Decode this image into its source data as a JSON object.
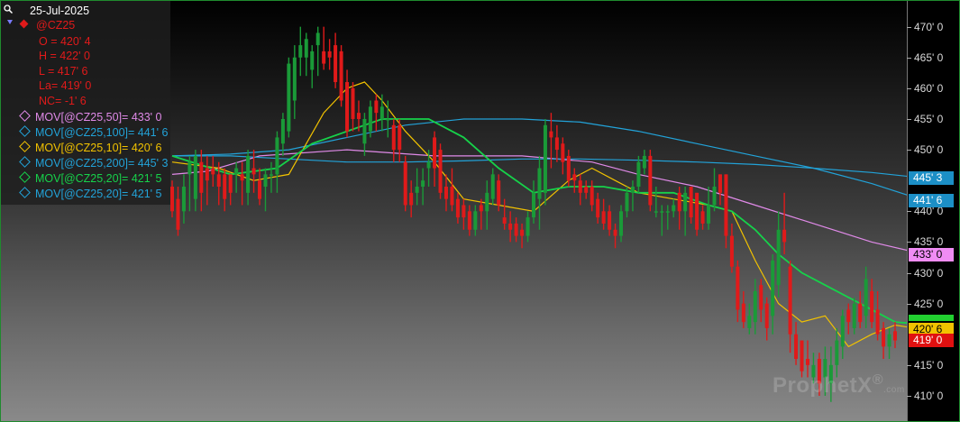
{
  "legend": {
    "date": "25-Jul-2025",
    "symbol": "@CZ25",
    "ohlc": [
      "O = 420' 4",
      "H = 422' 0",
      "L = 417' 6",
      "La= 419' 0",
      "NC= -1' 6"
    ],
    "studies": [
      {
        "label": "MOV[@CZ25,50]= 433' 0",
        "color": "#e08ae8"
      },
      {
        "label": "MOV[@CZ25,100]= 441' 6",
        "color": "#22a3d9"
      },
      {
        "label": "MOV[@CZ25,10]= 420' 6",
        "color": "#f2c200"
      },
      {
        "label": "MOV[@CZ25,200]= 445' 3",
        "color": "#22a3d9"
      },
      {
        "label": "MOV[@CZ25,20]= 421' 5",
        "color": "#16d24a"
      },
      {
        "label": "MOV[@CZ25,20]= 421' 5",
        "color": "#22a3d9"
      }
    ],
    "icons": {
      "zoom": "magnifier-icon",
      "collapse": "triangle-down-icon",
      "symbol": "red-diamond-icon"
    }
  },
  "axis": {
    "ticks": [
      {
        "label": "470' 0",
        "value": 470
      },
      {
        "label": "465' 0",
        "value": 465
      },
      {
        "label": "460' 0",
        "value": 460
      },
      {
        "label": "455' 0",
        "value": 455
      },
      {
        "label": "450' 0",
        "value": 450
      },
      {
        "label": "440' 0",
        "value": 440
      },
      {
        "label": "435' 0",
        "value": 435
      },
      {
        "label": "430' 0",
        "value": 430
      },
      {
        "label": "425' 0",
        "value": 425
      },
      {
        "label": "415' 0",
        "value": 415
      },
      {
        "label": "410' 0",
        "value": 410
      }
    ],
    "price_tags": [
      {
        "label": "445' 3",
        "value": 445.4,
        "bg": "#1c8fc6",
        "fg": "#ffffff"
      },
      {
        "label": "441' 6",
        "value": 441.75,
        "bg": "#1c8fc6",
        "fg": "#ffffff"
      },
      {
        "label": "433' 0",
        "value": 433,
        "bg": "#f08cf4",
        "fg": "#000000"
      },
      {
        "label": "",
        "value": 422.6,
        "bg": "#22d030",
        "fg": "#000000"
      },
      {
        "label": "420' 6",
        "value": 420.75,
        "bg": "#f2c200",
        "fg": "#000000"
      },
      {
        "label": "419' 0",
        "value": 419,
        "bg": "#e01010",
        "fg": "#ffffff"
      }
    ]
  },
  "watermark": {
    "brand": "ProphetX",
    "mark": "®",
    "suffix": ".com"
  },
  "chart_data": {
    "type": "candlestick",
    "symbol": "@CZ25",
    "ylim": [
      407.5,
      472
    ],
    "up_color": "#1a9a38",
    "down_color": "#e01a1a",
    "candles": [
      {
        "o": 444,
        "h": 445,
        "l": 439,
        "c": 440
      },
      {
        "o": 442,
        "h": 444,
        "l": 436,
        "c": 437
      },
      {
        "o": 440,
        "h": 446,
        "l": 438,
        "c": 444
      },
      {
        "o": 446,
        "h": 449,
        "l": 440,
        "c": 448
      },
      {
        "o": 442,
        "h": 450,
        "l": 440,
        "c": 449
      },
      {
        "o": 448,
        "h": 450,
        "l": 440,
        "c": 443
      },
      {
        "o": 447,
        "h": 449,
        "l": 441,
        "c": 445
      },
      {
        "o": 447,
        "h": 449,
        "l": 444,
        "c": 446
      },
      {
        "o": 446,
        "h": 448,
        "l": 441,
        "c": 444
      },
      {
        "o": 446,
        "h": 447,
        "l": 440,
        "c": 442
      },
      {
        "o": 446,
        "h": 446,
        "l": 441,
        "c": 443
      },
      {
        "o": 446,
        "h": 448,
        "l": 443,
        "c": 447
      },
      {
        "o": 446,
        "h": 448,
        "l": 441,
        "c": 445
      },
      {
        "o": 443,
        "h": 450,
        "l": 441,
        "c": 449
      },
      {
        "o": 447,
        "h": 450,
        "l": 443,
        "c": 446
      },
      {
        "o": 445,
        "h": 447,
        "l": 441,
        "c": 442
      },
      {
        "o": 444,
        "h": 447,
        "l": 440,
        "c": 446
      },
      {
        "o": 446,
        "h": 448,
        "l": 443,
        "c": 446
      },
      {
        "o": 446,
        "h": 453,
        "l": 443,
        "c": 452
      },
      {
        "o": 451,
        "h": 456,
        "l": 449,
        "c": 455
      },
      {
        "o": 453,
        "h": 465,
        "l": 452,
        "c": 464
      },
      {
        "o": 458,
        "h": 467,
        "l": 455,
        "c": 465
      },
      {
        "o": 465,
        "h": 470,
        "l": 462,
        "c": 467
      },
      {
        "o": 465,
        "h": 469,
        "l": 462,
        "c": 468
      },
      {
        "o": 463,
        "h": 467,
        "l": 460,
        "c": 466
      },
      {
        "o": 467,
        "h": 470,
        "l": 462,
        "c": 469
      },
      {
        "o": 466,
        "h": 470,
        "l": 463,
        "c": 464
      },
      {
        "o": 466,
        "h": 468,
        "l": 463,
        "c": 465
      },
      {
        "o": 467,
        "h": 469,
        "l": 460,
        "c": 461
      },
      {
        "o": 466,
        "h": 467,
        "l": 457,
        "c": 458
      },
      {
        "o": 461,
        "h": 463,
        "l": 452,
        "c": 453
      },
      {
        "o": 460,
        "h": 461,
        "l": 453,
        "c": 455
      },
      {
        "o": 456,
        "h": 458,
        "l": 453,
        "c": 455
      },
      {
        "o": 451,
        "h": 456,
        "l": 449,
        "c": 455
      },
      {
        "o": 453,
        "h": 458,
        "l": 452,
        "c": 457
      },
      {
        "o": 458,
        "h": 459,
        "l": 453,
        "c": 456
      },
      {
        "o": 455,
        "h": 459,
        "l": 453,
        "c": 457
      },
      {
        "o": 455,
        "h": 458,
        "l": 452,
        "c": 455
      },
      {
        "o": 454,
        "h": 455,
        "l": 448,
        "c": 450
      },
      {
        "o": 454,
        "h": 455,
        "l": 448,
        "c": 450
      },
      {
        "o": 448,
        "h": 449,
        "l": 440,
        "c": 441
      },
      {
        "o": 443,
        "h": 445,
        "l": 439,
        "c": 441
      },
      {
        "o": 443,
        "h": 447,
        "l": 441,
        "c": 444
      },
      {
        "o": 444,
        "h": 447,
        "l": 441,
        "c": 445
      },
      {
        "o": 447,
        "h": 450,
        "l": 444,
        "c": 448
      },
      {
        "o": 452,
        "h": 453,
        "l": 444,
        "c": 447
      },
      {
        "o": 450,
        "h": 451,
        "l": 442,
        "c": 443
      },
      {
        "o": 444,
        "h": 446,
        "l": 440,
        "c": 442
      },
      {
        "o": 444,
        "h": 447,
        "l": 440,
        "c": 441
      },
      {
        "o": 442,
        "h": 443,
        "l": 438,
        "c": 439
      },
      {
        "o": 441,
        "h": 442,
        "l": 437,
        "c": 439
      },
      {
        "o": 440,
        "h": 441,
        "l": 436,
        "c": 437
      },
      {
        "o": 437,
        "h": 441,
        "l": 436,
        "c": 440
      },
      {
        "o": 441,
        "h": 442,
        "l": 437,
        "c": 440
      },
      {
        "o": 440,
        "h": 445,
        "l": 437,
        "c": 443
      },
      {
        "o": 442,
        "h": 447,
        "l": 441,
        "c": 446
      },
      {
        "o": 445,
        "h": 446,
        "l": 440,
        "c": 441
      },
      {
        "o": 439,
        "h": 442,
        "l": 437,
        "c": 438
      },
      {
        "o": 438,
        "h": 440,
        "l": 435,
        "c": 437
      },
      {
        "o": 438,
        "h": 439,
        "l": 435,
        "c": 436
      },
      {
        "o": 437,
        "h": 438,
        "l": 434,
        "c": 436
      },
      {
        "o": 436,
        "h": 440,
        "l": 435,
        "c": 439
      },
      {
        "o": 439,
        "h": 445,
        "l": 438,
        "c": 443
      },
      {
        "o": 442,
        "h": 449,
        "l": 437,
        "c": 447
      },
      {
        "o": 443,
        "h": 455,
        "l": 441,
        "c": 454
      },
      {
        "o": 453,
        "h": 456,
        "l": 447,
        "c": 452
      },
      {
        "o": 452,
        "h": 454,
        "l": 448,
        "c": 450
      },
      {
        "o": 451,
        "h": 452,
        "l": 446,
        "c": 448
      },
      {
        "o": 449,
        "h": 450,
        "l": 444,
        "c": 445
      },
      {
        "o": 446,
        "h": 447,
        "l": 443,
        "c": 445
      },
      {
        "o": 445,
        "h": 446,
        "l": 441,
        "c": 443
      },
      {
        "o": 444,
        "h": 445,
        "l": 442,
        "c": 443
      },
      {
        "o": 444,
        "h": 445,
        "l": 440,
        "c": 441
      },
      {
        "o": 442,
        "h": 443,
        "l": 438,
        "c": 439
      },
      {
        "o": 440,
        "h": 442,
        "l": 437,
        "c": 438
      },
      {
        "o": 440,
        "h": 441,
        "l": 436,
        "c": 437
      },
      {
        "o": 437,
        "h": 438,
        "l": 434,
        "c": 436
      },
      {
        "o": 436,
        "h": 441,
        "l": 435,
        "c": 440
      },
      {
        "o": 440,
        "h": 444,
        "l": 439,
        "c": 443
      },
      {
        "o": 443,
        "h": 445,
        "l": 440,
        "c": 444
      },
      {
        "o": 444,
        "h": 449,
        "l": 443,
        "c": 448
      },
      {
        "o": 447,
        "h": 450,
        "l": 446,
        "c": 449
      },
      {
        "o": 449,
        "h": 450,
        "l": 440,
        "c": 441
      },
      {
        "o": 440,
        "h": 444,
        "l": 439,
        "c": 440
      },
      {
        "o": 440,
        "h": 441,
        "l": 436,
        "c": 440
      },
      {
        "o": 440,
        "h": 441,
        "l": 437,
        "c": 440
      },
      {
        "o": 440,
        "h": 442,
        "l": 439,
        "c": 441
      },
      {
        "o": 443,
        "h": 444,
        "l": 437,
        "c": 440
      },
      {
        "o": 440,
        "h": 444,
        "l": 436,
        "c": 443
      },
      {
        "o": 444,
        "h": 444,
        "l": 438,
        "c": 439
      },
      {
        "o": 443,
        "h": 443,
        "l": 436,
        "c": 437
      },
      {
        "o": 440,
        "h": 441,
        "l": 437,
        "c": 438
      },
      {
        "o": 438,
        "h": 444,
        "l": 437,
        "c": 441
      },
      {
        "o": 441,
        "h": 447,
        "l": 440,
        "c": 444
      },
      {
        "o": 446,
        "h": 446,
        "l": 441,
        "c": 443
      },
      {
        "o": 446,
        "h": 446,
        "l": 434,
        "c": 436
      },
      {
        "o": 436,
        "h": 438,
        "l": 430,
        "c": 431
      },
      {
        "o": 431,
        "h": 432,
        "l": 422,
        "c": 424
      },
      {
        "o": 425,
        "h": 427,
        "l": 421,
        "c": 422
      },
      {
        "o": 421,
        "h": 425,
        "l": 420,
        "c": 423
      },
      {
        "o": 422,
        "h": 429,
        "l": 420,
        "c": 427
      },
      {
        "o": 428,
        "h": 429,
        "l": 422,
        "c": 424
      },
      {
        "o": 425,
        "h": 426,
        "l": 419,
        "c": 421
      },
      {
        "o": 423,
        "h": 433,
        "l": 420,
        "c": 432
      },
      {
        "o": 428,
        "h": 440,
        "l": 426,
        "c": 437
      },
      {
        "o": 437,
        "h": 443,
        "l": 433,
        "c": 435
      },
      {
        "o": 431,
        "h": 432,
        "l": 417,
        "c": 420
      },
      {
        "o": 420,
        "h": 422,
        "l": 415,
        "c": 416
      },
      {
        "o": 419,
        "h": 419,
        "l": 413,
        "c": 414
      },
      {
        "o": 416,
        "h": 419,
        "l": 413,
        "c": 415
      },
      {
        "o": 413,
        "h": 417,
        "l": 412,
        "c": 415
      },
      {
        "o": 416,
        "h": 417,
        "l": 410,
        "c": 412
      },
      {
        "o": 413,
        "h": 418,
        "l": 410,
        "c": 416
      },
      {
        "o": 412,
        "h": 418,
        "l": 409,
        "c": 415
      },
      {
        "o": 415,
        "h": 421,
        "l": 413,
        "c": 419
      },
      {
        "o": 418,
        "h": 424,
        "l": 416,
        "c": 423
      },
      {
        "o": 424,
        "h": 425,
        "l": 420,
        "c": 422
      },
      {
        "o": 421,
        "h": 426,
        "l": 420,
        "c": 425
      },
      {
        "o": 425,
        "h": 427,
        "l": 421,
        "c": 422
      },
      {
        "o": 423,
        "h": 431,
        "l": 421,
        "c": 429
      },
      {
        "o": 427,
        "h": 429,
        "l": 421,
        "c": 422
      },
      {
        "o": 424,
        "h": 427,
        "l": 419,
        "c": 420
      },
      {
        "o": 421,
        "h": 422,
        "l": 416,
        "c": 418
      },
      {
        "o": 418,
        "h": 421,
        "l": 416,
        "c": 420
      },
      {
        "o": 420.5,
        "h": 422,
        "l": 417.75,
        "c": 419
      }
    ],
    "moving_averages": [
      {
        "name": "MOV[@CZ25,50]",
        "color": "#e08ae8",
        "points": [
          [
            0,
            446
          ],
          [
            6,
            446.5
          ],
          [
            15,
            449
          ],
          [
            30,
            450
          ],
          [
            45,
            449
          ],
          [
            60,
            449
          ],
          [
            72,
            448
          ],
          [
            80,
            446
          ],
          [
            90,
            444
          ],
          [
            100,
            441
          ],
          [
            110,
            438
          ],
          [
            120,
            435
          ],
          [
            129,
            433
          ]
        ]
      },
      {
        "name": "MOV[@CZ25,100]",
        "color": "#22a3d9",
        "points": [
          [
            0,
            449
          ],
          [
            10,
            449.3
          ],
          [
            20,
            450
          ],
          [
            30,
            452
          ],
          [
            40,
            454
          ],
          [
            50,
            455
          ],
          [
            60,
            455
          ],
          [
            70,
            454.5
          ],
          [
            80,
            453
          ],
          [
            90,
            451
          ],
          [
            100,
            449
          ],
          [
            110,
            447
          ],
          [
            120,
            444.5
          ],
          [
            129,
            441.75
          ]
        ]
      },
      {
        "name": "MOV[@CZ25,200]",
        "color": "#22a3d9",
        "points": [
          [
            0,
            449
          ],
          [
            10,
            449
          ],
          [
            20,
            448.5
          ],
          [
            30,
            448
          ],
          [
            40,
            448
          ],
          [
            50,
            448.2
          ],
          [
            60,
            448.5
          ],
          [
            70,
            448.5
          ],
          [
            80,
            448.3
          ],
          [
            90,
            448
          ],
          [
            100,
            447.6
          ],
          [
            110,
            447
          ],
          [
            120,
            446.3
          ],
          [
            129,
            445.4
          ]
        ]
      },
      {
        "name": "MOV[@CZ25,10]",
        "color": "#f2c200",
        "points": [
          [
            0,
            448
          ],
          [
            8,
            447
          ],
          [
            14,
            445
          ],
          [
            20,
            446
          ],
          [
            26,
            456
          ],
          [
            30,
            460
          ],
          [
            33,
            461
          ],
          [
            36,
            458
          ],
          [
            40,
            453
          ],
          [
            45,
            448
          ],
          [
            50,
            442
          ],
          [
            56,
            441
          ],
          [
            62,
            440
          ],
          [
            68,
            445
          ],
          [
            72,
            447
          ],
          [
            76,
            445
          ],
          [
            80,
            443
          ],
          [
            86,
            442
          ],
          [
            92,
            441
          ],
          [
            96,
            440
          ],
          [
            100,
            432
          ],
          [
            104,
            425
          ],
          [
            108,
            422
          ],
          [
            112,
            423
          ],
          [
            116,
            418
          ],
          [
            120,
            420
          ],
          [
            124,
            421.5
          ],
          [
            129,
            420.75
          ]
        ]
      },
      {
        "name": "MOV[@CZ25,20]",
        "color": "#16d24a",
        "points": [
          [
            0,
            449
          ],
          [
            10,
            446
          ],
          [
            18,
            447
          ],
          [
            24,
            451
          ],
          [
            30,
            453
          ],
          [
            36,
            455
          ],
          [
            44,
            455
          ],
          [
            50,
            452
          ],
          [
            56,
            447
          ],
          [
            62,
            443
          ],
          [
            68,
            444
          ],
          [
            74,
            444
          ],
          [
            80,
            443
          ],
          [
            86,
            443
          ],
          [
            92,
            441
          ],
          [
            96,
            440
          ],
          [
            100,
            437
          ],
          [
            104,
            433
          ],
          [
            108,
            430
          ],
          [
            112,
            428
          ],
          [
            116,
            426
          ],
          [
            120,
            424
          ],
          [
            124,
            422
          ],
          [
            129,
            421.6
          ]
        ]
      }
    ]
  }
}
